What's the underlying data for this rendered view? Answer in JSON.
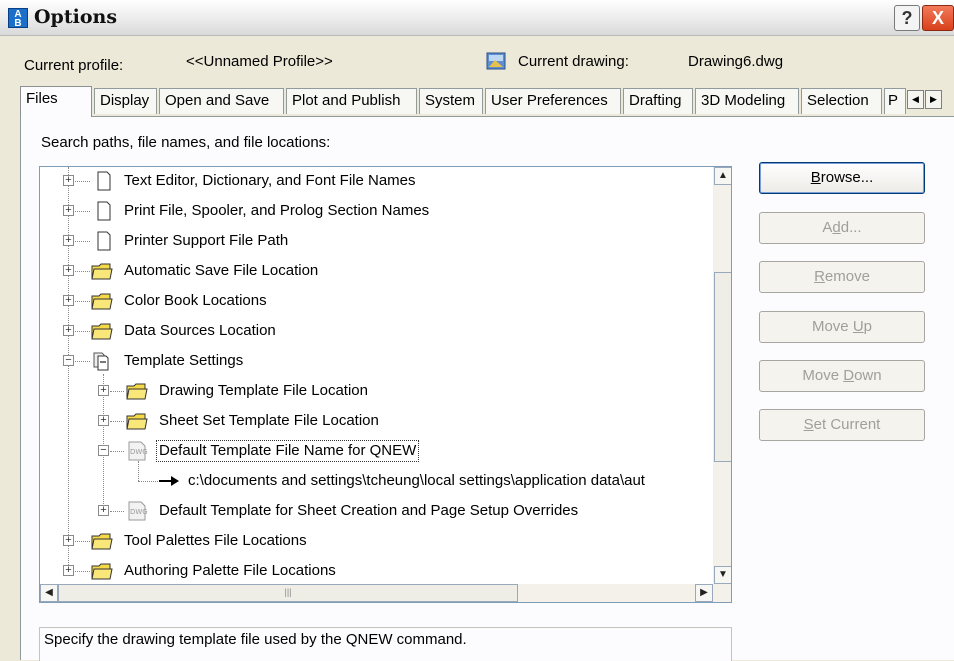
{
  "window": {
    "title": "Options",
    "help_label": "?",
    "close_label": "X"
  },
  "profile": {
    "current_profile_label": "Current profile:",
    "current_profile_value": "<<Unnamed Profile>>",
    "current_drawing_label": "Current drawing:",
    "current_drawing_value": "Drawing6.dwg"
  },
  "tabs": [
    {
      "label": "Files"
    },
    {
      "label": "Display"
    },
    {
      "label": "Open and Save"
    },
    {
      "label": "Plot and Publish"
    },
    {
      "label": "System"
    },
    {
      "label": "User Preferences"
    },
    {
      "label": "Drafting"
    },
    {
      "label": "3D Modeling"
    },
    {
      "label": "Selection"
    },
    {
      "label": "P"
    }
  ],
  "search_label": "Search paths, file names, and file locations:",
  "tree": {
    "items": [
      {
        "label": "Text Editor, Dictionary, and Font File Names",
        "icon": "document-icon"
      },
      {
        "label": "Print File, Spooler, and Prolog Section Names",
        "icon": "document-icon"
      },
      {
        "label": "Printer Support File Path",
        "icon": "document-icon"
      },
      {
        "label": "Automatic Save File Location",
        "icon": "folder-icon"
      },
      {
        "label": "Color Book Locations",
        "icon": "folder-icon"
      },
      {
        "label": "Data Sources Location",
        "icon": "folder-icon"
      },
      {
        "label": "Template Settings",
        "icon": "template-icon"
      },
      {
        "label": "Drawing Template File Location",
        "icon": "folder-icon"
      },
      {
        "label": "Sheet Set Template File Location",
        "icon": "folder-icon"
      },
      {
        "label": "Default Template File Name for QNEW",
        "icon": "dwg-file-icon"
      },
      {
        "label": "c:\\documents and settings\\tcheung\\local settings\\application data\\aut",
        "icon": "arrow-icon"
      },
      {
        "label": "Default Template for Sheet Creation and Page Setup Overrides",
        "icon": "dwg-file-icon"
      },
      {
        "label": "Tool Palettes File Locations",
        "icon": "folder-icon"
      },
      {
        "label": "Authoring Palette File Locations",
        "icon": "folder-icon"
      }
    ]
  },
  "buttons": {
    "browse": {
      "pre": "",
      "key": "B",
      "post": "rowse..."
    },
    "add": {
      "pre": "A",
      "key": "d",
      "post": "d..."
    },
    "remove": {
      "pre": "",
      "key": "R",
      "post": "emove"
    },
    "move_up": {
      "pre": "Move ",
      "key": "U",
      "post": "p"
    },
    "move_down": {
      "pre": "Move ",
      "key": "D",
      "post": "own"
    },
    "set_current": {
      "pre": "",
      "key": "S",
      "post": "et Current"
    }
  },
  "description": "Specify the drawing template file used by the QNEW command.",
  "colors": {
    "dialog_bg": "#ece9d8",
    "panel_bg": "#fcfcfe",
    "disabled_text": "#a09f98",
    "folder_yellow": "#f5d949"
  }
}
